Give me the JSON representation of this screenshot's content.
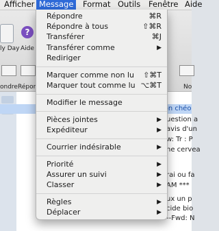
{
  "menubar": {
    "items": [
      {
        "label": "Afficher"
      },
      {
        "label": "Message"
      },
      {
        "label": "Format"
      },
      {
        "label": "Outils"
      },
      {
        "label": "Fenêtre"
      },
      {
        "label": "Aide"
      }
    ]
  },
  "toolbar": {
    "labels": [
      "ly Day",
      "Aide",
      "ondre",
      "Répon",
      "No"
    ]
  },
  "message_list": {
    "snippets": [
      "tion chéo",
      "uestion a",
      "avis d'un",
      "w: Tr : P",
      "ne cervea",
      "rai ou fa",
      "AM ***",
      "ux un p",
      "cide bio",
      "--Fwd: N"
    ]
  },
  "menu": {
    "sections": [
      [
        {
          "label": "Répondre",
          "shortcut": "⌘R"
        },
        {
          "label": "Répondre à tous",
          "shortcut": "⇧⌘R"
        },
        {
          "label": "Transférer",
          "shortcut": "⌘J"
        },
        {
          "label": "Transférer comme",
          "submenu": true
        },
        {
          "label": "Rediriger"
        }
      ],
      [
        {
          "label": "Marquer comme non lu",
          "shortcut": "⇧⌘T"
        },
        {
          "label": "Marquer tout comme lu",
          "shortcut": "⌥⌘T"
        }
      ],
      [
        {
          "label": "Modifier le message"
        }
      ],
      [
        {
          "label": "Pièces jointes",
          "submenu": true
        },
        {
          "label": "Expéditeur",
          "submenu": true
        }
      ],
      [
        {
          "label": "Courrier indésirable",
          "submenu": true
        }
      ],
      [
        {
          "label": "Priorité",
          "submenu": true
        },
        {
          "label": "Assurer un suivi",
          "submenu": true
        },
        {
          "label": "Classer",
          "submenu": true
        }
      ],
      [
        {
          "label": "Règles",
          "submenu": true
        },
        {
          "label": "Déplacer",
          "submenu": true
        }
      ]
    ]
  }
}
